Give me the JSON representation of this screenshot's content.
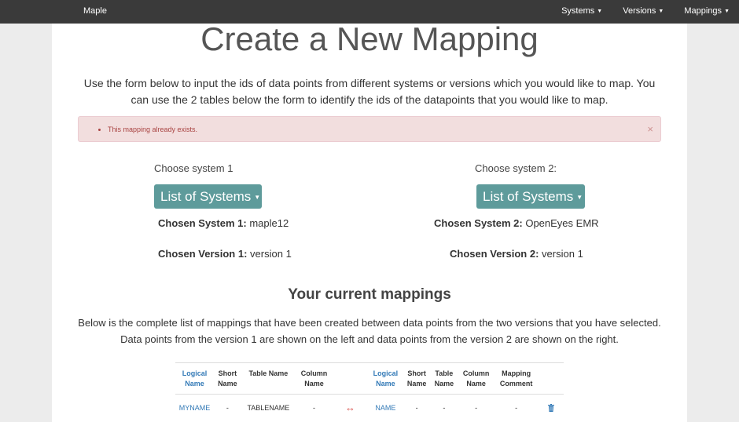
{
  "navbar": {
    "brand": "Maple",
    "menus": [
      {
        "label": "Systems"
      },
      {
        "label": "Versions"
      },
      {
        "label": "Mappings"
      }
    ]
  },
  "page": {
    "title": "Create a New Mapping",
    "intro": "Use the form below to input the ids of data points from different systems or versions which you would like to map. You can use the 2 tables below the form to identify the ids of the datapoints that you would like to map."
  },
  "alert": {
    "message": "This mapping already exists.",
    "close_glyph": "×"
  },
  "left": {
    "choose_label": "Choose system 1",
    "button_label": "List of Systems",
    "chosen_system_label": "Chosen System 1:",
    "chosen_system_value": "maple12",
    "chosen_version_label": "Chosen Version 1:",
    "chosen_version_value": "version 1"
  },
  "right": {
    "choose_label": "Choose system 2:",
    "button_label": "List of Systems",
    "chosen_system_label": "Chosen System 2:",
    "chosen_system_value": "OpenEyes EMR",
    "chosen_version_label": "Chosen Version 2:",
    "chosen_version_value": "version 1"
  },
  "mappings": {
    "title": "Your current mappings",
    "description": "Below is the complete list of mappings that have been created between data points from the two versions that you have selected. Data points from the version 1 are shown on the left and data points from the version 2 are shown on the right.",
    "headers": {
      "logical_1": "Logical Name",
      "short_1": "Short Name",
      "table_1": "Table Name",
      "column_1": "Column Name",
      "logical_2": "Logical Name",
      "short_2": "Short Name",
      "table_2": "Table Name",
      "column_2": "Column Name",
      "comment": "Mapping Comment"
    },
    "rows": [
      {
        "logical_1": "MYNAME",
        "short_1": "-",
        "table_1": "TABLENAME",
        "column_1": "-",
        "arrow": "↔",
        "logical_2": "NAME",
        "short_2": "-",
        "table_2": "-",
        "column_2": "-",
        "comment": "-"
      }
    ]
  },
  "colors": {
    "navbar": "#3a3a3a",
    "button": "#5e9b9b",
    "link": "#337ab7",
    "alert_bg": "#f2dede",
    "alert_text": "#a94442",
    "arrow": "#d9534f"
  },
  "icons": {
    "delete": "trash-icon",
    "menu_caret": "caret-down-icon",
    "close": "close-icon"
  }
}
